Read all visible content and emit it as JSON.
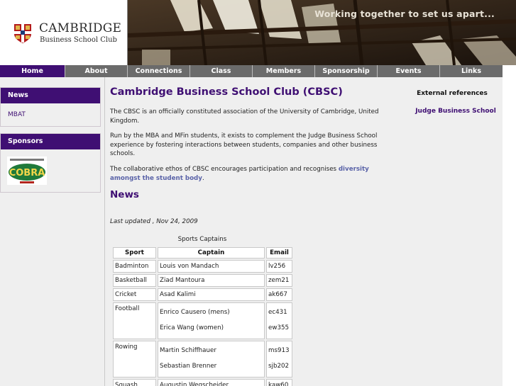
{
  "header": {
    "logo_title": "CAMBRIDGE",
    "logo_subtitle": "Business School Club",
    "tagline": "Working together to set us apart..."
  },
  "nav": {
    "items": [
      {
        "label": "Home",
        "active": true
      },
      {
        "label": "About"
      },
      {
        "label": "Connections"
      },
      {
        "label": "Class"
      },
      {
        "label": "Members"
      },
      {
        "label": "Sponsorship"
      },
      {
        "label": "Events"
      },
      {
        "label": "Links"
      }
    ]
  },
  "sidebar": {
    "news_heading": "News",
    "news_link": "MBAT",
    "sponsors_heading": "Sponsors",
    "sponsor_logo_text": "COBRA"
  },
  "main": {
    "title": "Cambridge Business School Club (CBSC)",
    "para1": "The CBSC is an officially constituted association of the University of Cambridge, United Kingdom.",
    "para2": "Run by the MBA and MFin students, it exists to complement the Judge Business School experience by fostering interactions between students, companies and other business schools.",
    "para3_prefix": "The collaborative ethos of CBSC encourages participation and recognises ",
    "para3_link": "diversity amongst the student body",
    "para3_suffix": ".",
    "news_title": "News",
    "last_updated": "Last updated , Nov 24, 2009",
    "table": {
      "caption": "Sports Captains",
      "headers": [
        "Sport",
        "Captain",
        "Email"
      ],
      "rows": [
        {
          "sport": "Badminton",
          "captains": [
            "Louis von Mandach"
          ],
          "emails": [
            "lv256"
          ]
        },
        {
          "sport": "Basketball",
          "captains": [
            "Ziad Mantoura"
          ],
          "emails": [
            "zem21"
          ]
        },
        {
          "sport": "Cricket",
          "captains": [
            "Asad Kalimi"
          ],
          "emails": [
            "ak667"
          ]
        },
        {
          "sport": "Football",
          "captains": [
            "Enrico Causero (mens)",
            "Erica Wang (women)"
          ],
          "emails": [
            "ec431",
            "ew355"
          ]
        },
        {
          "sport": "Rowing",
          "captains": [
            "Martin Schiffhauer",
            "Sebastian Brenner"
          ],
          "emails": [
            "ms913",
            "sjb202"
          ]
        },
        {
          "sport": "Squash",
          "captains": [
            "Augustin Wegscheider"
          ],
          "emails": [
            "kaw60"
          ]
        }
      ]
    }
  },
  "right": {
    "heading": "External references",
    "link": "Judge Business School"
  },
  "colors": {
    "brand_purple": "#3f0f73",
    "nav_gray": "#6b6b6b",
    "link_blue": "#5a63a8"
  }
}
